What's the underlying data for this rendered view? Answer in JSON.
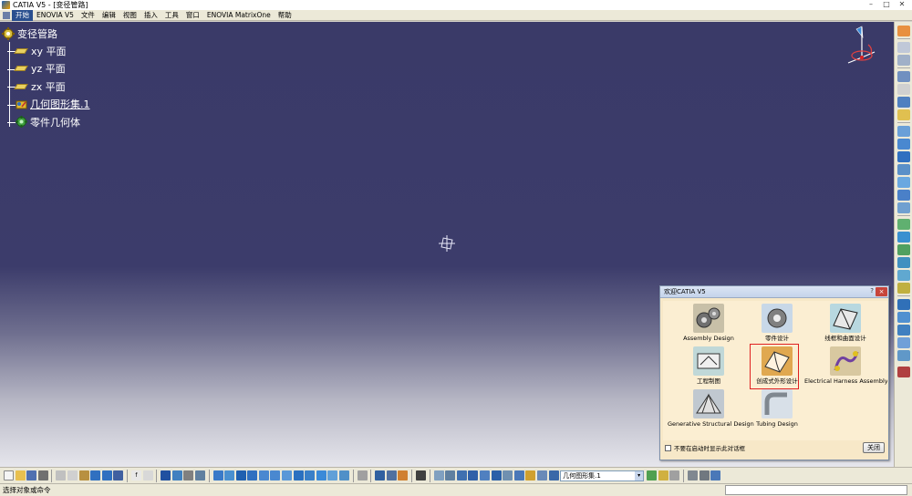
{
  "window": {
    "title": "CATIA V5 - [变径管路]"
  },
  "menu": [
    "开始",
    "ENOVIA V5",
    "文件",
    "编辑",
    "视图",
    "插入",
    "工具",
    "窗口",
    "ENOVIA MatrixOne",
    "帮助"
  ],
  "tree": {
    "root": "变径管路",
    "items": [
      {
        "label": "xy 平面",
        "icon": "plane-icon"
      },
      {
        "label": "yz 平面",
        "icon": "plane-icon"
      },
      {
        "label": "zx 平面",
        "icon": "plane-icon"
      },
      {
        "label": "几何图形集.1",
        "icon": "geometrical-set-icon"
      },
      {
        "label": "零件几何体",
        "icon": "part-body-icon"
      }
    ]
  },
  "welcome": {
    "title": "欢迎CATIA V5",
    "help": "?",
    "close_x": "×",
    "tiles": [
      {
        "label": "Assembly Design",
        "icon": "assembly-gears-icon"
      },
      {
        "label": "零件设计",
        "icon": "part-gear-icon"
      },
      {
        "label": "线框和曲面设计",
        "icon": "wireframe-surface-icon"
      },
      {
        "label": "工程制图",
        "icon": "drafting-icon"
      },
      {
        "label": "创成式外形设计",
        "icon": "generative-shape-icon"
      },
      {
        "label": "Electrical Harness Assembly",
        "icon": "harness-icon"
      },
      {
        "label": "Generative Structural Design",
        "icon": "structural-icon"
      },
      {
        "label": "Tubing Design",
        "icon": "tubing-icon"
      }
    ],
    "checkbox_label": "不要在启动时显示此对话框",
    "close_button": "关闭"
  },
  "toolbar": {
    "combo_value": "几何图形集.1",
    "combo_arrow": "▾"
  },
  "status": {
    "text": "选择对象或命令"
  }
}
